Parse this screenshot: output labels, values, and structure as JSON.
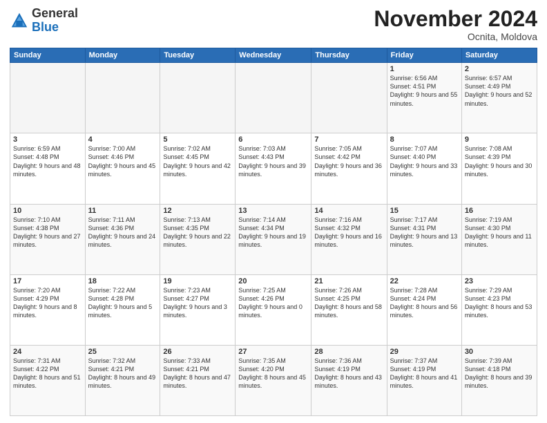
{
  "logo": {
    "general": "General",
    "blue": "Blue"
  },
  "header": {
    "month": "November 2024",
    "location": "Ocnita, Moldova"
  },
  "weekdays": [
    "Sunday",
    "Monday",
    "Tuesday",
    "Wednesday",
    "Thursday",
    "Friday",
    "Saturday"
  ],
  "weeks": [
    [
      {
        "day": "",
        "info": ""
      },
      {
        "day": "",
        "info": ""
      },
      {
        "day": "",
        "info": ""
      },
      {
        "day": "",
        "info": ""
      },
      {
        "day": "",
        "info": ""
      },
      {
        "day": "1",
        "info": "Sunrise: 6:56 AM\nSunset: 4:51 PM\nDaylight: 9 hours and 55 minutes."
      },
      {
        "day": "2",
        "info": "Sunrise: 6:57 AM\nSunset: 4:49 PM\nDaylight: 9 hours and 52 minutes."
      }
    ],
    [
      {
        "day": "3",
        "info": "Sunrise: 6:59 AM\nSunset: 4:48 PM\nDaylight: 9 hours and 48 minutes."
      },
      {
        "day": "4",
        "info": "Sunrise: 7:00 AM\nSunset: 4:46 PM\nDaylight: 9 hours and 45 minutes."
      },
      {
        "day": "5",
        "info": "Sunrise: 7:02 AM\nSunset: 4:45 PM\nDaylight: 9 hours and 42 minutes."
      },
      {
        "day": "6",
        "info": "Sunrise: 7:03 AM\nSunset: 4:43 PM\nDaylight: 9 hours and 39 minutes."
      },
      {
        "day": "7",
        "info": "Sunrise: 7:05 AM\nSunset: 4:42 PM\nDaylight: 9 hours and 36 minutes."
      },
      {
        "day": "8",
        "info": "Sunrise: 7:07 AM\nSunset: 4:40 PM\nDaylight: 9 hours and 33 minutes."
      },
      {
        "day": "9",
        "info": "Sunrise: 7:08 AM\nSunset: 4:39 PM\nDaylight: 9 hours and 30 minutes."
      }
    ],
    [
      {
        "day": "10",
        "info": "Sunrise: 7:10 AM\nSunset: 4:38 PM\nDaylight: 9 hours and 27 minutes."
      },
      {
        "day": "11",
        "info": "Sunrise: 7:11 AM\nSunset: 4:36 PM\nDaylight: 9 hours and 24 minutes."
      },
      {
        "day": "12",
        "info": "Sunrise: 7:13 AM\nSunset: 4:35 PM\nDaylight: 9 hours and 22 minutes."
      },
      {
        "day": "13",
        "info": "Sunrise: 7:14 AM\nSunset: 4:34 PM\nDaylight: 9 hours and 19 minutes."
      },
      {
        "day": "14",
        "info": "Sunrise: 7:16 AM\nSunset: 4:32 PM\nDaylight: 9 hours and 16 minutes."
      },
      {
        "day": "15",
        "info": "Sunrise: 7:17 AM\nSunset: 4:31 PM\nDaylight: 9 hours and 13 minutes."
      },
      {
        "day": "16",
        "info": "Sunrise: 7:19 AM\nSunset: 4:30 PM\nDaylight: 9 hours and 11 minutes."
      }
    ],
    [
      {
        "day": "17",
        "info": "Sunrise: 7:20 AM\nSunset: 4:29 PM\nDaylight: 9 hours and 8 minutes."
      },
      {
        "day": "18",
        "info": "Sunrise: 7:22 AM\nSunset: 4:28 PM\nDaylight: 9 hours and 5 minutes."
      },
      {
        "day": "19",
        "info": "Sunrise: 7:23 AM\nSunset: 4:27 PM\nDaylight: 9 hours and 3 minutes."
      },
      {
        "day": "20",
        "info": "Sunrise: 7:25 AM\nSunset: 4:26 PM\nDaylight: 9 hours and 0 minutes."
      },
      {
        "day": "21",
        "info": "Sunrise: 7:26 AM\nSunset: 4:25 PM\nDaylight: 8 hours and 58 minutes."
      },
      {
        "day": "22",
        "info": "Sunrise: 7:28 AM\nSunset: 4:24 PM\nDaylight: 8 hours and 56 minutes."
      },
      {
        "day": "23",
        "info": "Sunrise: 7:29 AM\nSunset: 4:23 PM\nDaylight: 8 hours and 53 minutes."
      }
    ],
    [
      {
        "day": "24",
        "info": "Sunrise: 7:31 AM\nSunset: 4:22 PM\nDaylight: 8 hours and 51 minutes."
      },
      {
        "day": "25",
        "info": "Sunrise: 7:32 AM\nSunset: 4:21 PM\nDaylight: 8 hours and 49 minutes."
      },
      {
        "day": "26",
        "info": "Sunrise: 7:33 AM\nSunset: 4:21 PM\nDaylight: 8 hours and 47 minutes."
      },
      {
        "day": "27",
        "info": "Sunrise: 7:35 AM\nSunset: 4:20 PM\nDaylight: 8 hours and 45 minutes."
      },
      {
        "day": "28",
        "info": "Sunrise: 7:36 AM\nSunset: 4:19 PM\nDaylight: 8 hours and 43 minutes."
      },
      {
        "day": "29",
        "info": "Sunrise: 7:37 AM\nSunset: 4:19 PM\nDaylight: 8 hours and 41 minutes."
      },
      {
        "day": "30",
        "info": "Sunrise: 7:39 AM\nSunset: 4:18 PM\nDaylight: 8 hours and 39 minutes."
      }
    ]
  ]
}
